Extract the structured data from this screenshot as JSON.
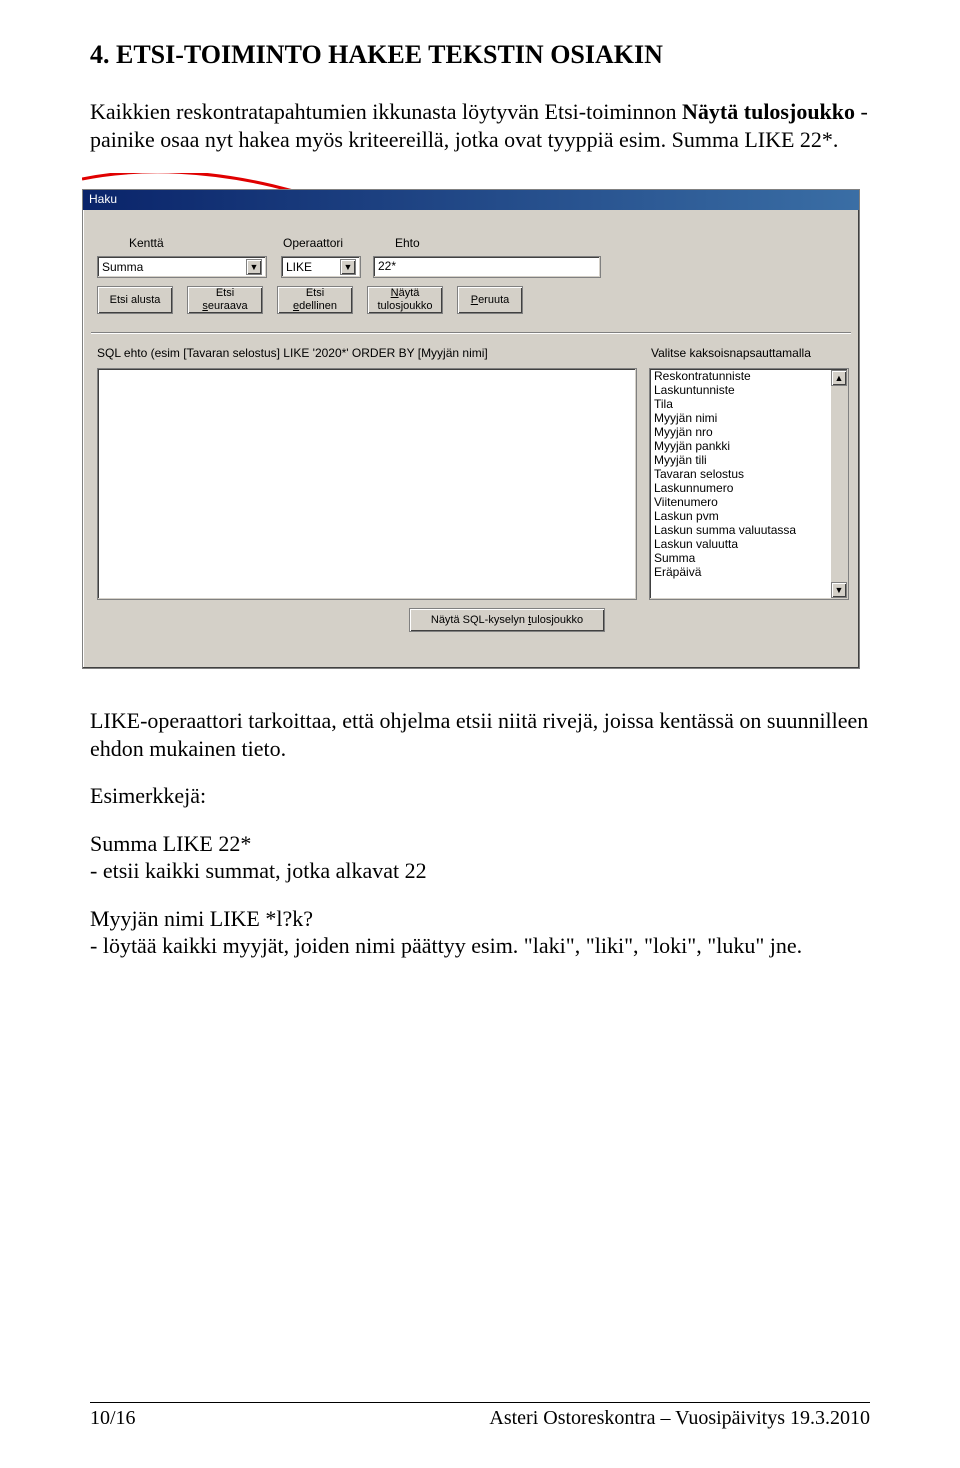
{
  "heading": "4.  ETSI-TOIMINTO HAKEE TEKSTIN OSIAKIN",
  "para1_a": "Kaikkien reskontratapahtumien ikkunasta löytyvän Etsi-toiminnon",
  "para1_bold": "Näytä tulosjoukko",
  "para1_b": " -painike osaa nyt hakea myös kriteereillä, jotka ovat tyyppiä esim. Summa LIKE 22*.",
  "dialog": {
    "title": "Haku",
    "labels": {
      "kentta": "Kenttä",
      "operaattori": "Operaattori",
      "ehto": "Ehto"
    },
    "kentta_value": "Summa",
    "oper_value": "LIKE",
    "ehto_value": "22*",
    "buttons": {
      "alusta": "Etsi alusta",
      "seuraava": [
        "Etsi",
        "seuraava"
      ],
      "edellinen": [
        "Etsi",
        "edellinen"
      ],
      "tulos": [
        "Näytä",
        "tulosjoukko"
      ],
      "peruuta": "Peruuta"
    },
    "sql_label_left": "SQL ehto (esim [Tavaran selostus] LIKE '2020*' ORDER BY [Myyjän nimi]",
    "sql_label_right": "Valitse kaksoisnapsauttamalla",
    "sql_button": "Näytä SQL-kyselyn tulosjoukko",
    "list": [
      "Reskontratunniste",
      "Laskuntunniste",
      "Tila",
      "Myyjän nimi",
      "Myyjän nro",
      "Myyjän pankki",
      "Myyjän tili",
      "Tavaran selostus",
      "Laskunnumero",
      "Viitenumero",
      "Laskun pvm",
      "Laskun summa valuutassa",
      "Laskun valuutta",
      "Summa",
      "Eräpäivä"
    ]
  },
  "para2": "LIKE-operaattori tarkoittaa, että ohjelma etsii niitä rivejä, joissa kentässä on suunnilleen ehdon mukainen tieto.",
  "para3": "Esimerkkejä:",
  "ex1_head": "Summa LIKE 22*",
  "ex1_body": "- etsii kaikki summat, jotka alkavat 22",
  "ex2_head": "Myyjän nimi LIKE *l?k?",
  "ex2_body": "- löytää kaikki myyjät, joiden nimi päättyy esim. \"laki\", \"liki\", \"loki\", \"luku\" jne.",
  "footer_left": "10/16",
  "footer_right": "Asteri Ostoreskontra – Vuosipäivitys 19.3.2010"
}
